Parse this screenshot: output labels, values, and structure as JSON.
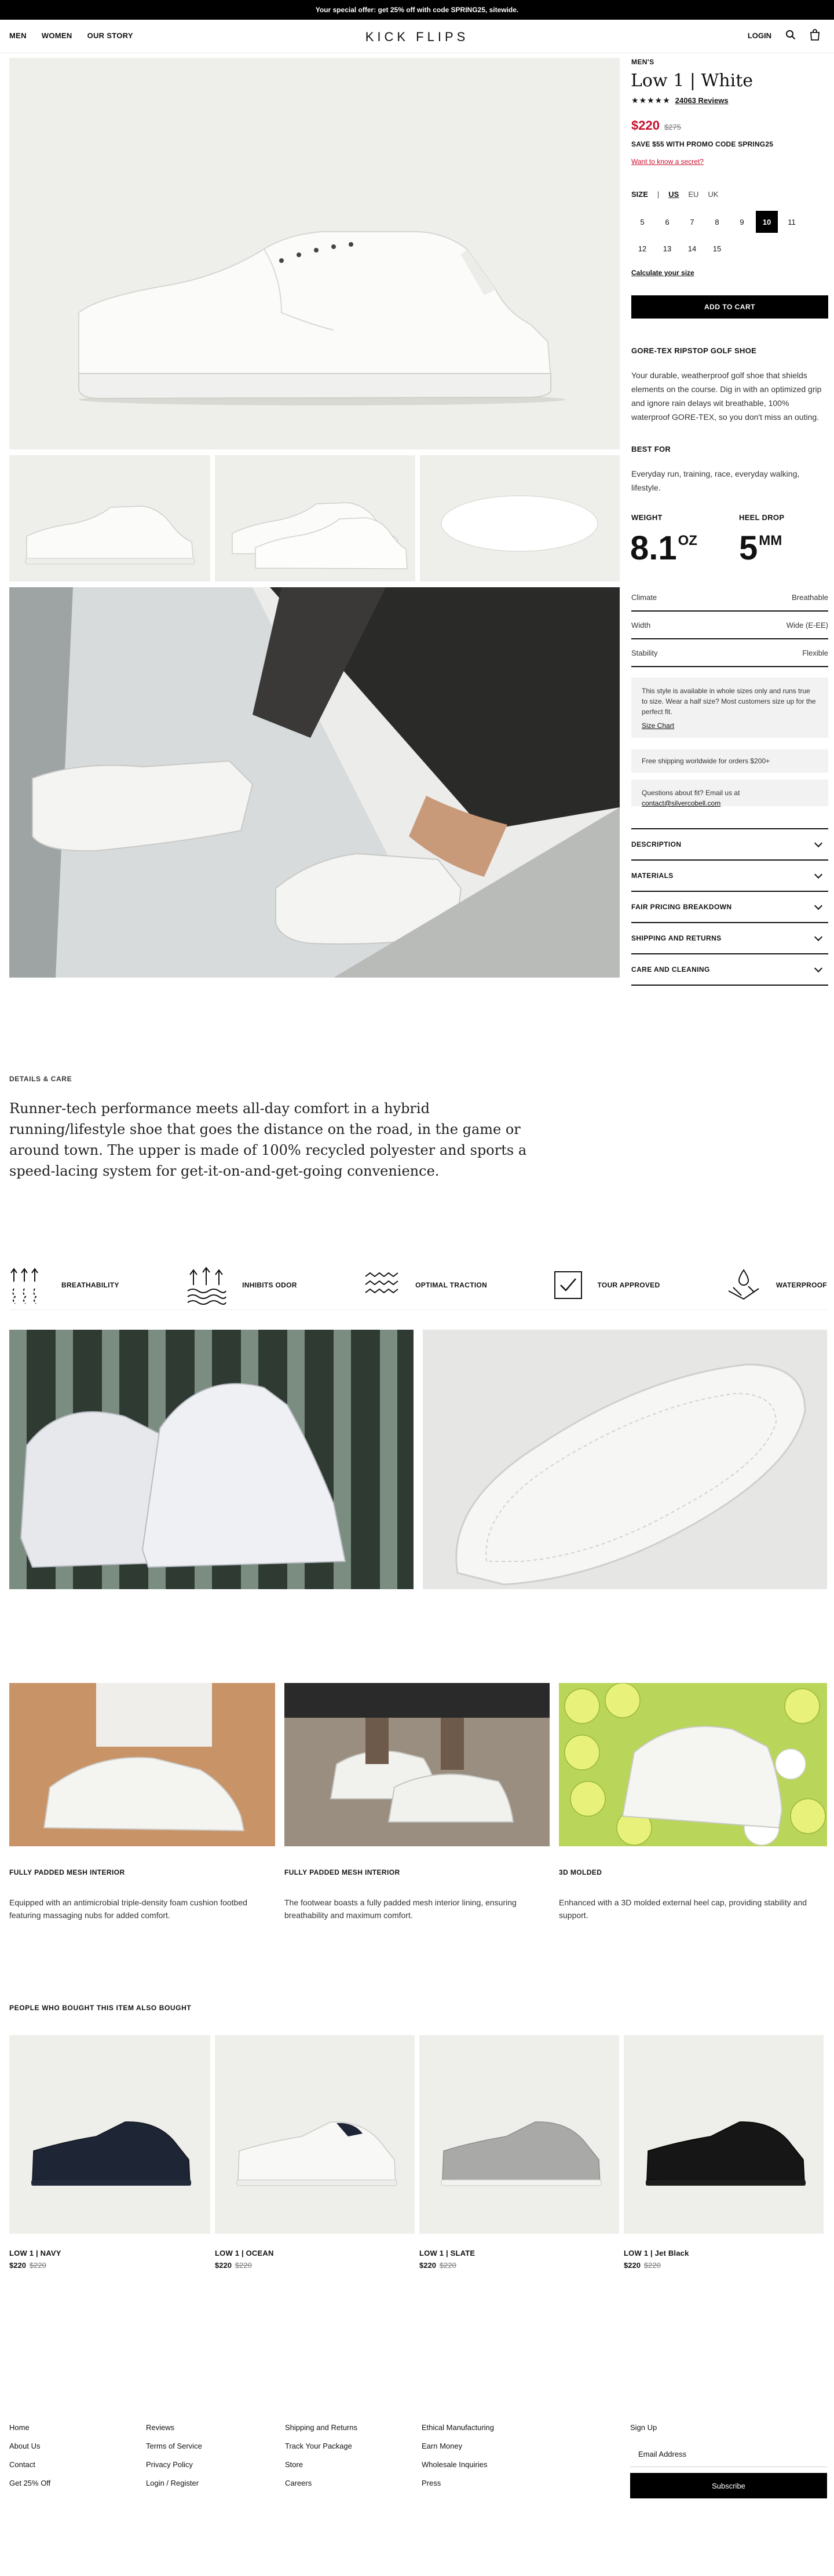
{
  "announcement": {
    "text": "Your special offer: get 25% off with code SPRING25, sitewide."
  },
  "header": {
    "nav": [
      "MEN",
      "WOMEN",
      "OUR STORY"
    ],
    "logo": "KICK FLIPS",
    "login": "LOGIN",
    "icons": [
      "search-icon",
      "bag-icon"
    ]
  },
  "product": {
    "category": "MEN'S",
    "title": "Low 1 | White",
    "stars": "★★★★★",
    "rating": 5,
    "reviews": "24063 Reviews",
    "price": "$220",
    "old_price": "$275",
    "promo": "SAVE $55 WITH PROMO CODE SPRING25",
    "secret_link": "Want to know a secret?",
    "size_label": "SIZE",
    "size_sep": "|",
    "size_units": [
      "US",
      "EU",
      "UK"
    ],
    "active_unit": "US",
    "sizes": [
      "5",
      "6",
      "7",
      "8",
      "9",
      "10",
      "11",
      "12",
      "13",
      "14",
      "15"
    ],
    "selected_size": "10",
    "calc_size": "Calculate your size",
    "add_to_cart": "ADD TO CART",
    "subtitle": "GORE-TEX RIPSTOP GOLF SHOE",
    "description": "Your durable, weatherproof golf shoe that shields elements on the course. Dig in with an optimized grip and ignore rain delays wit breathable, 100% waterproof GORE-TEX, so you don't miss an outing.",
    "best_for_label": "BEST FOR",
    "best_for": "Everyday run, training, race, everyday walking, lifestyle.",
    "weight_label": "WEIGHT",
    "weight_value": "8.1",
    "weight_unit": "OZ",
    "heel_label": "HEEL DROP",
    "heel_value": "5",
    "heel_unit": "MM",
    "specs": [
      {
        "label": "Climate",
        "value": "Breathable"
      },
      {
        "label": "Width",
        "value": "Wide (E-EE)"
      },
      {
        "label": "Stability",
        "value": "Flexible"
      }
    ],
    "fit_note": "This style is available in whole sizes only and runs true to size. Wear a half size? Most customers size up for the perfect fit.",
    "size_chart": "Size Chart",
    "shipping_note": "Free shipping worldwide for orders $200+",
    "fit_question": "Questions about fit? Email us at",
    "fit_email": "contact@silvercobell.com",
    "accordion": [
      "DESCRIPTION",
      "MATERIALS",
      "FAIR PRICING BREAKDOWN",
      "SHIPPING AND RETURNS",
      "CARE AND CLEANING"
    ]
  },
  "details": {
    "eyebrow": "DETAILS & CARE",
    "text": "Runner-tech performance meets all-day comfort in a hybrid running/lifestyle shoe that goes the distance on the road, in the game or around town. The upper is made of 100% recycled polyester and sports a speed-lacing system for get-it-on-and-get-going convenience.",
    "features": [
      {
        "icon": "breathability-icon",
        "label": "BREATHABILITY"
      },
      {
        "icon": "inhibits-odor-icon",
        "label": "INHIBITS ODOR"
      },
      {
        "icon": "traction-icon",
        "label": "OPTIMAL TRACTION"
      },
      {
        "icon": "tour-approved-icon",
        "label": "TOUR APPROVED"
      },
      {
        "icon": "waterproof-icon",
        "label": "WATERPROOF"
      }
    ]
  },
  "columns": [
    {
      "title": "FULLY PADDED MESH INTERIOR",
      "text": "Equipped with an antimicrobial triple-density foam cushion footbed featuring massaging nubs for added comfort."
    },
    {
      "title": "FULLY PADDED MESH INTERIOR",
      "text": "The footwear boasts a fully padded mesh interior lining, ensuring breathability and maximum comfort."
    },
    {
      "title": "3D MOLDED",
      "text": "Enhanced with a 3D molded external heel cap, providing stability and support."
    }
  ],
  "also_bought": {
    "title": "PEOPLE WHO BOUGHT THIS ITEM ALSO BOUGHT",
    "items": [
      {
        "name": "LOW 1 | NAVY",
        "price": "$220",
        "old_price": "$220",
        "color": "#1e2535"
      },
      {
        "name": "LOW 1 | OCEAN",
        "price": "$220",
        "old_price": "$220",
        "color": "#f4f4f2"
      },
      {
        "name": "LOW 1 | SLATE",
        "price": "$220",
        "old_price": "$220",
        "color": "#a9a9a8"
      },
      {
        "name": "LOW 1 | Jet Black",
        "price": "$220",
        "old_price": "$220",
        "color": "#161616"
      }
    ]
  },
  "footer": {
    "col1": [
      "Home",
      "About Us",
      "Contact",
      "Get 25% Off"
    ],
    "col2": [
      "Reviews",
      "Terms of Service",
      "Privacy Policy",
      "Login / Register"
    ],
    "col3": [
      "Shipping and Returns",
      "Track Your Package",
      "Store",
      "Careers"
    ],
    "col4": [
      "Ethical Manufacturing",
      "Earn Money",
      "Wholesale Inquiries",
      "Press"
    ],
    "signup_label": "Sign Up",
    "email_placeholder": "Email Address",
    "subscribe": "Subscribe"
  },
  "colors": {
    "accent_red": "#c8102e",
    "black": "#000000",
    "image_bg": "#eeeeea"
  }
}
